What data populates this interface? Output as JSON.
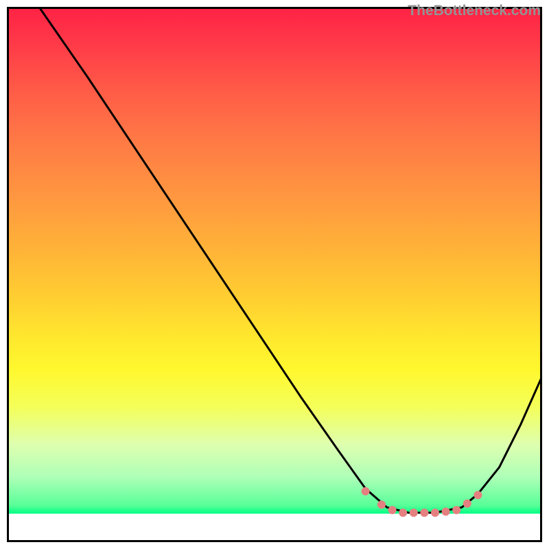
{
  "watermark": "TheBottleneck.com",
  "chart_data": {
    "type": "line",
    "title": "",
    "xlabel": "",
    "ylabel": "",
    "description": "A bottleneck curve over a vertical rainbow gradient (red at top through yellow to green near bottom). The black curve descends from top-left, flattens at a minimum around x≈0.72–0.86 near the bottom green band, then rises toward the right. A cluster of salmon-pink dotted markers sits along the flat minimum region.",
    "curve": {
      "x": [
        0.06,
        0.15,
        0.25,
        0.35,
        0.45,
        0.55,
        0.62,
        0.67,
        0.71,
        0.75,
        0.8,
        0.85,
        0.88,
        0.92,
        0.96,
        1.0
      ],
      "y": [
        0.0,
        0.13,
        0.28,
        0.43,
        0.58,
        0.73,
        0.83,
        0.9,
        0.935,
        0.945,
        0.945,
        0.935,
        0.91,
        0.86,
        0.78,
        0.69
      ]
    },
    "markers": {
      "color": "#e58080",
      "x": [
        0.67,
        0.7,
        0.72,
        0.74,
        0.76,
        0.78,
        0.8,
        0.82,
        0.84,
        0.86,
        0.88
      ],
      "y": [
        0.905,
        0.93,
        0.94,
        0.945,
        0.945,
        0.945,
        0.945,
        0.943,
        0.94,
        0.928,
        0.912
      ]
    },
    "xlim": [
      0,
      1
    ],
    "ylim": [
      0,
      1
    ]
  }
}
